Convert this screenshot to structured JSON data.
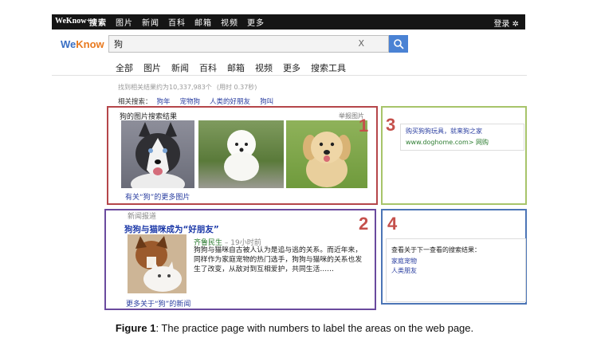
{
  "topbar": {
    "brand": "WeKnow+",
    "nav": [
      "搜索",
      "图片",
      "新闻",
      "百科",
      "邮箱",
      "视频",
      "更多"
    ],
    "login": "登录 ✲"
  },
  "logo": {
    "we": "We",
    "know": "Know"
  },
  "search": {
    "value": "狗",
    "clear": "X"
  },
  "tabs": [
    "全部",
    "图片",
    "新闻",
    "百科",
    "邮箱",
    "视频",
    "更多",
    "搜索工具"
  ],
  "stats": {
    "text": "找到相关结果约为10,337,983个",
    "time": "(用时 0.37秒)"
  },
  "related": {
    "label": "相关搜索：",
    "items": [
      "狗年",
      "宠物狗",
      "人类的好朋友",
      "狗叫"
    ]
  },
  "area1": {
    "title": "狗的图片搜索结果",
    "extra": "举报图片",
    "more": "有关“狗”的更多图片"
  },
  "area2": {
    "header": "新闻报道",
    "title": "狗狗与猫咪成为“好朋友”",
    "source": "齐鲁民生",
    "ago": "– 19小时前",
    "body": "狗狗与猫咪自古被人认为是追与逃的关系。而近年来，同样作为家庭宠物的热门选手，狗狗与猫咪的关系也发生了改变，从敌对到互相爱护，共同生活……",
    "more": "更多关于“狗”的新闻"
  },
  "area3": {
    "ad_line1": "购买狗狗玩具，就来狗之家",
    "ad_line2": "www.doghome.com> 网购"
  },
  "area4": {
    "header": "查看关于下一查看的搜索结果：",
    "links": [
      "家庭宠物",
      "人类朋友"
    ]
  },
  "numbers": [
    "1",
    "2",
    "3",
    "4"
  ],
  "caption": {
    "label": "Figure 1",
    "text": ": The practice page with numbers to label the areas on the web page."
  },
  "colors": {
    "area1": "#b5464a",
    "area2": "#6a4a9e",
    "area3": "#a7c46a",
    "area4": "#4c75b6",
    "number": "#c5504b"
  }
}
